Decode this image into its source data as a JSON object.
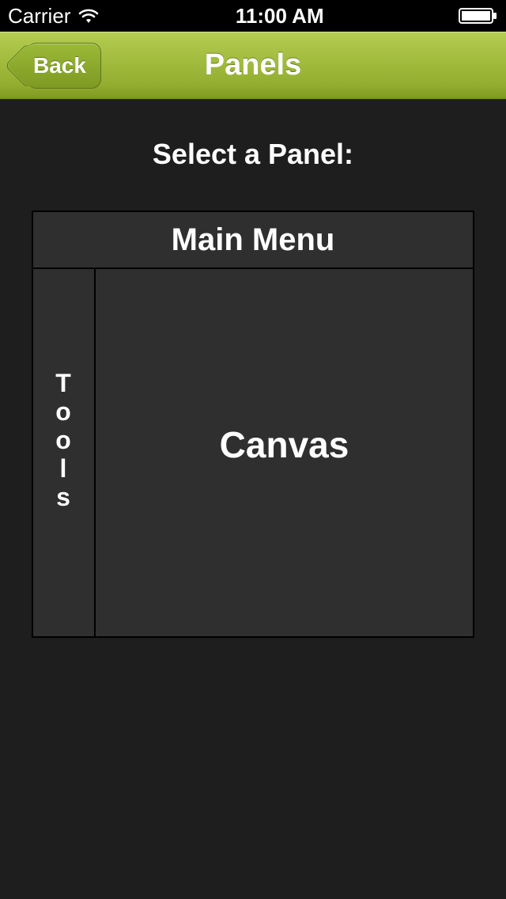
{
  "status_bar": {
    "carrier": "Carrier",
    "time": "11:00 AM"
  },
  "nav": {
    "back_label": "Back",
    "title": "Panels"
  },
  "content": {
    "heading": "Select a Panel:",
    "panels": {
      "main_menu": "Main Menu",
      "tools": "Tools",
      "canvas": "Canvas"
    }
  },
  "colors": {
    "accent": "#92ad2f",
    "background": "#1e1e1e",
    "panel": "#2f2f2f"
  }
}
